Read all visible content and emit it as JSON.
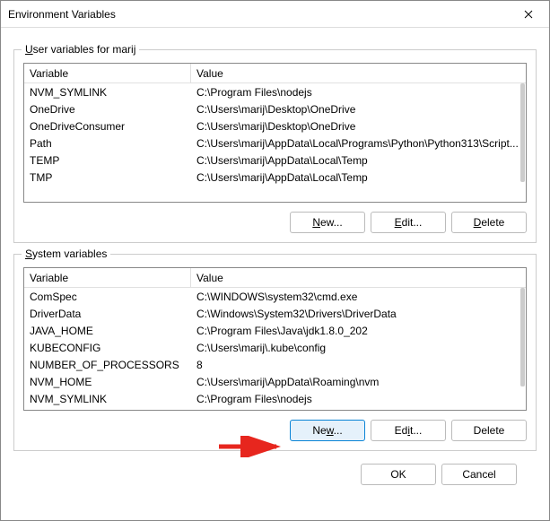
{
  "window": {
    "title": "Environment Variables"
  },
  "userSection": {
    "legend": {
      "underlined": "U",
      "rest": "ser variables for marij"
    },
    "columns": {
      "variable": "Variable",
      "value": "Value"
    },
    "rows": [
      {
        "name": "NVM_SYMLINK",
        "value": "C:\\Program Files\\nodejs"
      },
      {
        "name": "OneDrive",
        "value": "C:\\Users\\marij\\Desktop\\OneDrive"
      },
      {
        "name": "OneDriveConsumer",
        "value": "C:\\Users\\marij\\Desktop\\OneDrive"
      },
      {
        "name": "Path",
        "value": "C:\\Users\\marij\\AppData\\Local\\Programs\\Python\\Python313\\Script..."
      },
      {
        "name": "TEMP",
        "value": "C:\\Users\\marij\\AppData\\Local\\Temp"
      },
      {
        "name": "TMP",
        "value": "C:\\Users\\marij\\AppData\\Local\\Temp"
      }
    ],
    "buttons": {
      "new": {
        "u": "N",
        "rest": "ew..."
      },
      "edit": {
        "u": "E",
        "rest": "dit..."
      },
      "delete": {
        "u": "D",
        "rest": "elete"
      }
    }
  },
  "systemSection": {
    "legend": {
      "underlined": "S",
      "rest": "ystem variables"
    },
    "columns": {
      "variable": "Variable",
      "value": "Value"
    },
    "rows": [
      {
        "name": "ComSpec",
        "value": "C:\\WINDOWS\\system32\\cmd.exe"
      },
      {
        "name": "DriverData",
        "value": "C:\\Windows\\System32\\Drivers\\DriverData"
      },
      {
        "name": "JAVA_HOME",
        "value": "C:\\Program Files\\Java\\jdk1.8.0_202"
      },
      {
        "name": "KUBECONFIG",
        "value": "C:\\Users\\marij\\.kube\\config"
      },
      {
        "name": "NUMBER_OF_PROCESSORS",
        "value": "8"
      },
      {
        "name": "NVM_HOME",
        "value": "C:\\Users\\marij\\AppData\\Roaming\\nvm"
      },
      {
        "name": "NVM_SYMLINK",
        "value": "C:\\Program Files\\nodejs"
      }
    ],
    "buttons": {
      "new": {
        "u": "w",
        "pre": "Ne",
        "rest": "..."
      },
      "edit": {
        "u": "i",
        "pre": "Ed",
        "rest": "t..."
      },
      "delete": {
        "u": "L",
        "pre": "De",
        "rest": "ete",
        "plain": "Delete"
      }
    }
  },
  "footer": {
    "ok": "OK",
    "cancel": "Cancel"
  }
}
